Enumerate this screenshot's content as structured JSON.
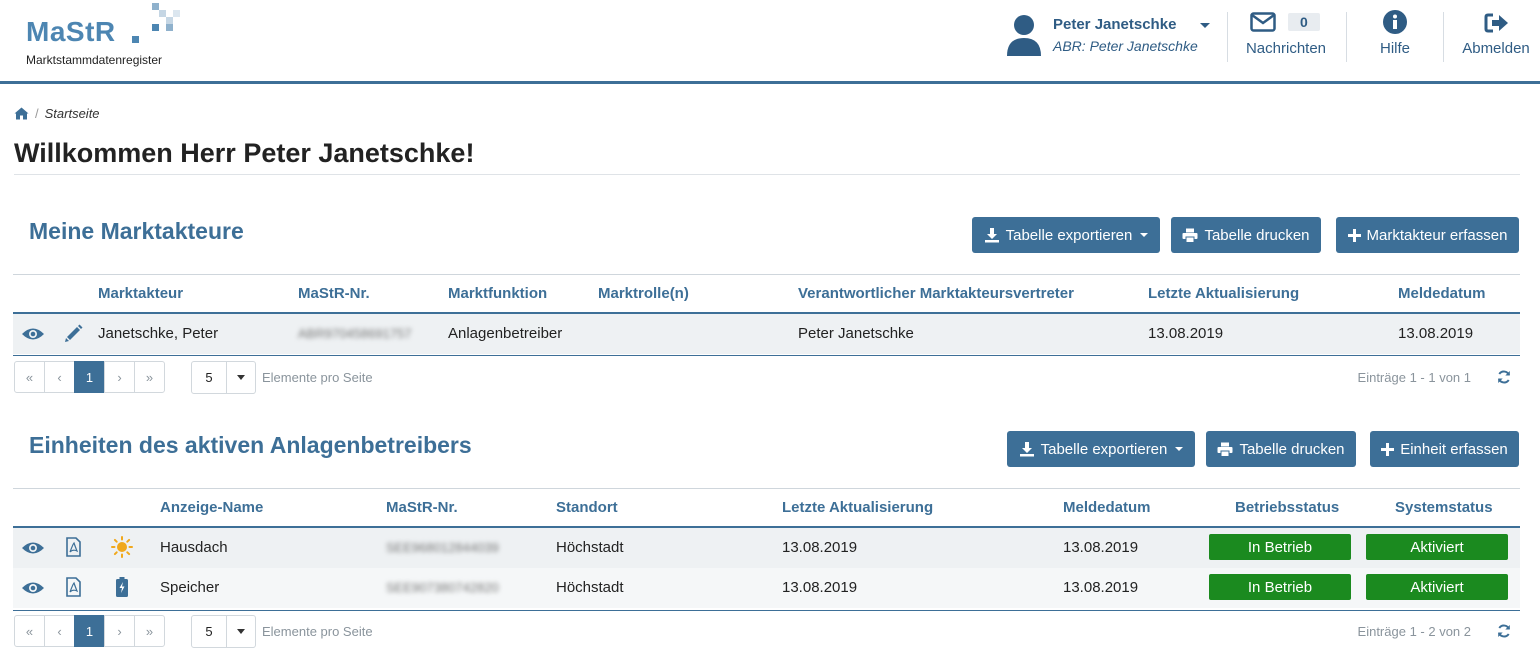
{
  "brand": {
    "logo": "MaStR",
    "subtitle": "Marktstammdatenregister"
  },
  "user": {
    "name": "Peter Janetschke",
    "abr": "ABR: Peter Janetschke"
  },
  "header_nav": {
    "messages_count": "0",
    "messages_label": "Nachrichten",
    "help_label": "Hilfe",
    "logout_label": "Abmelden"
  },
  "breadcrumb": {
    "current": "Startseite"
  },
  "page_title": "Willkommen Herr Peter Janetschke!",
  "akteure": {
    "title": "Meine Marktakteure",
    "buttons": {
      "export": "Tabelle exportieren",
      "print": "Tabelle drucken",
      "add": "Marktakteur erfassen"
    },
    "columns": [
      "Marktakteur",
      "MaStR-Nr.",
      "Marktfunktion",
      "Marktrolle(n)",
      "Verantwortlicher Marktakteursvertreter",
      "Letzte Aktualisierung",
      "Meldedatum"
    ],
    "rows": [
      {
        "name": "Janetschke, Peter",
        "nr": "ABR970458691757",
        "funktion": "Anlagenbetreiber",
        "rolle": "",
        "vertreter": "Peter Janetschke",
        "aktualisiert": "13.08.2019",
        "meldedatum": "13.08.2019"
      }
    ],
    "pager": {
      "page": "1",
      "page_size": "5",
      "per_page_label": "Elemente pro Seite",
      "entries": "Einträge 1 - 1 von 1"
    }
  },
  "einheiten": {
    "title": "Einheiten des aktiven Anlagenbetreibers",
    "buttons": {
      "export": "Tabelle exportieren",
      "print": "Tabelle drucken",
      "add": "Einheit erfassen"
    },
    "columns": [
      "Anzeige-Name",
      "MaStR-Nr.",
      "Standort",
      "Letzte Aktualisierung",
      "Meldedatum",
      "Betriebsstatus",
      "Systemstatus"
    ],
    "rows": [
      {
        "type_icon": "sun-icon",
        "name": "Hausdach",
        "nr": "SEE968012844039",
        "standort": "Höchstadt",
        "aktualisiert": "13.08.2019",
        "meldedatum": "13.08.2019",
        "betrieb": "In Betrieb",
        "system": "Aktiviert"
      },
      {
        "type_icon": "battery-icon",
        "name": "Speicher",
        "nr": "SEE907380742820",
        "standort": "Höchstadt",
        "aktualisiert": "13.08.2019",
        "meldedatum": "13.08.2019",
        "betrieb": "In Betrieb",
        "system": "Aktiviert"
      }
    ],
    "pager": {
      "page": "1",
      "page_size": "5",
      "per_page_label": "Elemente pro Seite",
      "entries": "Einträge 1 - 2 von 2"
    }
  },
  "colors": {
    "primary": "#3d6f97",
    "logo": "#4d86b2",
    "status_green": "#1b8a1f",
    "sun": "#f0a81c"
  }
}
